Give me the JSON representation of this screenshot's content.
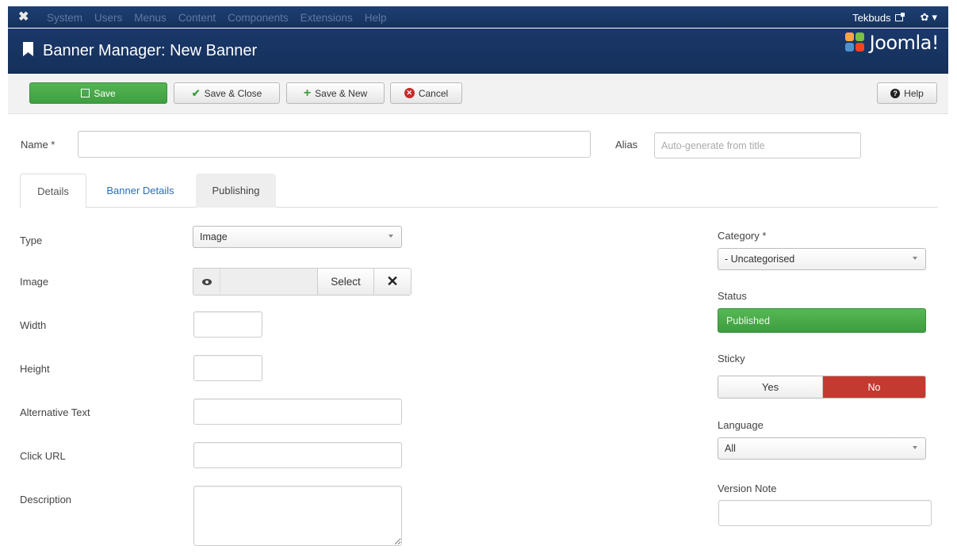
{
  "nav": {
    "menu": [
      "System",
      "Users",
      "Menus",
      "Content",
      "Components",
      "Extensions",
      "Help"
    ],
    "user": "Tekbuds",
    "settings_caret": "▾"
  },
  "header": {
    "title": "Banner Manager: New Banner",
    "logo_text": "Joomla!"
  },
  "toolbar": {
    "save": "Save",
    "save_close": "Save & Close",
    "save_new": "Save & New",
    "cancel": "Cancel",
    "help": "Help"
  },
  "form": {
    "name_label": "Name *",
    "name_value": "",
    "alias_label": "Alias",
    "alias_placeholder": "Auto-generate from title"
  },
  "tabs": [
    "Details",
    "Banner Details",
    "Publishing"
  ],
  "details": {
    "type_label": "Type",
    "type_value": "Image",
    "image_label": "Image",
    "image_select": "Select",
    "image_clear": "✕",
    "width_label": "Width",
    "height_label": "Height",
    "alt_label": "Alternative Text",
    "click_url_label": "Click URL",
    "description_label": "Description"
  },
  "sidebar": {
    "category_label": "Category *",
    "category_value": "- Uncategorised",
    "status_label": "Status",
    "status_value": "Published",
    "sticky_label": "Sticky",
    "sticky_yes": "Yes",
    "sticky_no": "No",
    "language_label": "Language",
    "language_value": "All",
    "version_note_label": "Version Note"
  },
  "colors": {
    "navbar": "#1a3867",
    "save_green": "#46a546",
    "no_red": "#c33a30",
    "link_blue": "#2a6fb4"
  }
}
